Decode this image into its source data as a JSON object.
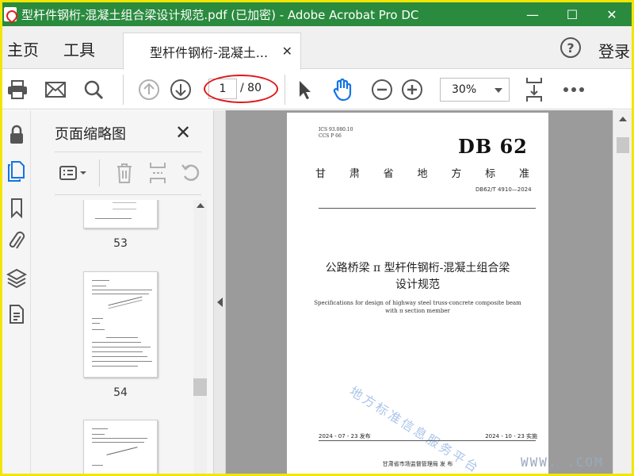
{
  "window": {
    "title": "型杆件钢桁-混凝土组合梁设计规范.pdf (已加密) - Adobe Acrobat Pro DC",
    "minimize": "—",
    "maximize": "☐",
    "close": "✕"
  },
  "menu": {
    "home": "主页",
    "tools": "工具",
    "doc_tab": "型杆件钢桁-混凝土...",
    "doc_tab_close": "✕",
    "help": "?",
    "login": "登录"
  },
  "toolbar": {
    "page_current": "1",
    "page_total": "/ 80",
    "zoom": "30%"
  },
  "thumbnails_panel": {
    "title": "页面缩略图",
    "close": "✕",
    "pages": [
      {
        "label": "53"
      },
      {
        "label": "54"
      }
    ]
  },
  "document": {
    "ics": "ICS  93.080.10",
    "ccs": "CCS  P 66",
    "logo": "DB 62",
    "province_chars": [
      "甘",
      "肃",
      "省",
      "地",
      "方",
      "标",
      "准"
    ],
    "standard_number": "DB62/T 4910—2024",
    "title_cn_line1": "公路桥梁 π 型杆件钢桁-混凝土组合梁",
    "title_cn_line2": "设计规范",
    "title_en_line1": "Specifications for design of highway steel truss-concrete composite beam",
    "title_en_line2": "with π section member",
    "watermark": "地方标准信息服务平台",
    "publish_date": "2024 - 07 - 23 发布",
    "implement_date": "2024 - 10 - 23 实施",
    "publisher": "甘肃省市场监督管理局        发 布",
    "url_watermark": "WWW.          .COM"
  }
}
